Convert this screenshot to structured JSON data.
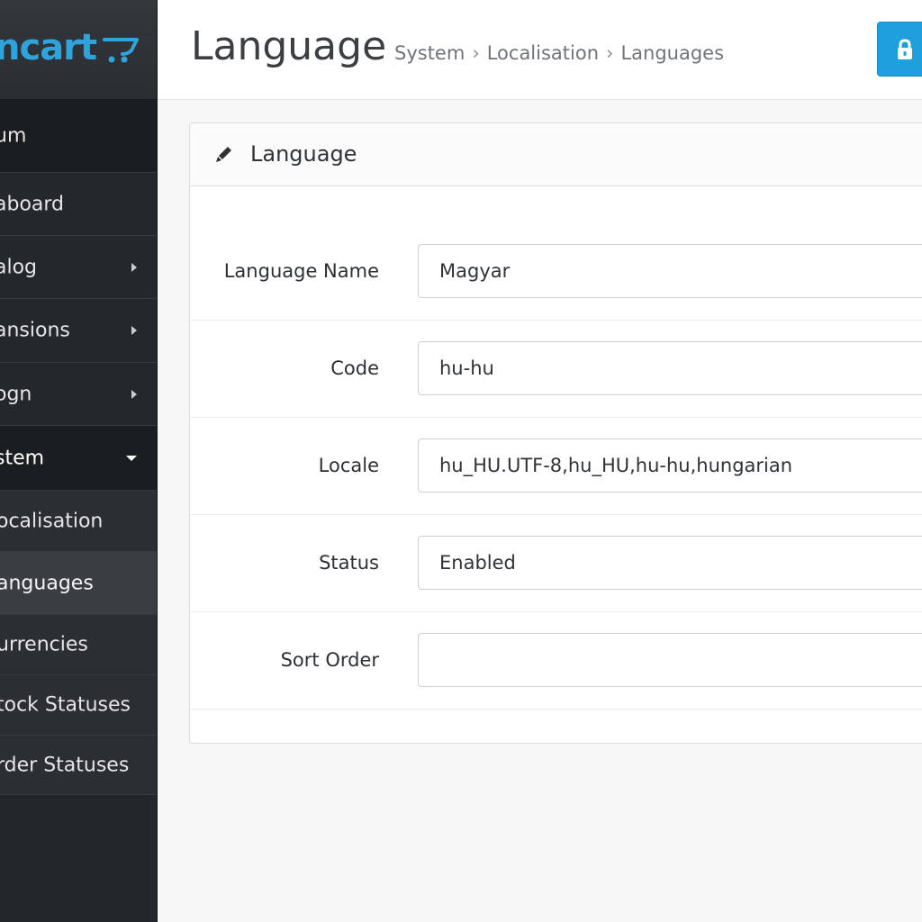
{
  "brand": {
    "name": "opencart",
    "visible_text": "ncart",
    "color": "#2fa4dc"
  },
  "sidebar": {
    "items": [
      {
        "label": "um",
        "arrow": ""
      },
      {
        "label": "aboard",
        "arrow": ""
      },
      {
        "label": "alog",
        "arrow": "right"
      },
      {
        "label": "ansions",
        "arrow": "right"
      },
      {
        "label": "ogn",
        "arrow": "right"
      },
      {
        "label": "stem",
        "arrow": "down"
      },
      {
        "label": "ocalisation",
        "arrow": ""
      },
      {
        "label": "anguages",
        "arrow": ""
      },
      {
        "label": "urrencies",
        "arrow": ""
      },
      {
        "label": "tock Statuses",
        "arrow": ""
      },
      {
        "label": "rder Statuses",
        "arrow": ""
      }
    ],
    "active_item": "anguages"
  },
  "header": {
    "title": "Language",
    "breadcrumb": [
      "System",
      "Localisation",
      "Languages"
    ],
    "breadcrumb_separator": "›",
    "lock_button_icon": "lock-icon",
    "accent_color": "#1f9fdc"
  },
  "panel": {
    "icon": "pencil-icon",
    "title": "Language"
  },
  "form": {
    "fields": [
      {
        "label": "Language Name",
        "value": "Magyar",
        "placeholder": ""
      },
      {
        "label": "Code",
        "value": "hu-hu",
        "placeholder": ""
      },
      {
        "label": "Locale",
        "value": "hu_HU.UTF-8,hu_HU,hu-hu,hungarian",
        "placeholder": ""
      },
      {
        "label": "Status",
        "value": "Enabled",
        "placeholder": ""
      },
      {
        "label": "Sort Order",
        "value": "",
        "placeholder": ""
      }
    ]
  }
}
